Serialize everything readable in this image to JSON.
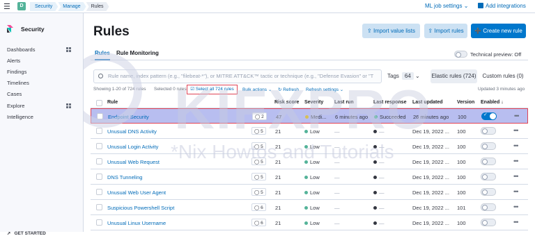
{
  "header": {
    "space_initial": "D",
    "breadcrumbs": [
      "Security",
      "Manage",
      "Rules"
    ],
    "ml_jobs": "ML job settings",
    "add_integrations": "Add integrations"
  },
  "sidebar": {
    "title": "Security",
    "items": [
      {
        "label": "Dashboards",
        "has_grid": true
      },
      {
        "label": "Alerts",
        "has_grid": false
      },
      {
        "label": "Findings",
        "has_grid": false
      },
      {
        "label": "Timelines",
        "has_grid": false
      },
      {
        "label": "Cases",
        "has_grid": false
      },
      {
        "label": "Explore",
        "has_grid": true
      },
      {
        "label": "Intelligence",
        "has_grid": false
      }
    ],
    "get_started": "GET STARTED"
  },
  "page": {
    "title": "Rules",
    "import_value_lists": "Import value lists",
    "import_rules": "Import rules",
    "create_rule": "Create new rule",
    "tabs": [
      "Rules",
      "Rule Monitoring"
    ],
    "technical_preview": "Technical preview: Off"
  },
  "search": {
    "placeholder": "Rule name, index pattern (e.g., \"filebeat-*\"), or MITRE ATT&CK™ tactic or technique (e.g., \"Defense Evasion\" or \"T"
  },
  "filters": {
    "tags_label": "Tags",
    "tags_count": "64",
    "elastic_rules": "Elastic rules (724)",
    "custom_rules": "Custom rules (0)"
  },
  "toolbar": {
    "showing": "Showing 1-20 of 724 rules",
    "selected": "Selected 0 rules",
    "select_all": "Select all 724 rules",
    "bulk_actions": "Bulk actions",
    "refresh": "Refresh",
    "refresh_settings": "Refresh settings",
    "updated": "Updated 3 minutes ago"
  },
  "table": {
    "columns": [
      "Rule",
      "Risk score",
      "Severity",
      "Last run",
      "Last response",
      "Last updated",
      "Version",
      "Enabled"
    ],
    "rows": [
      {
        "name": "Endpoint Security",
        "tags": "2",
        "risk": "47",
        "severity": "Medi...",
        "sev_color": "#d6bf57",
        "last_run": "6 minutes ago",
        "last_response": "Succeeded",
        "resp_color": "#54b399",
        "last_updated": "26 minutes ago",
        "version": "100",
        "enabled": true
      },
      {
        "name": "Unusual DNS Activity",
        "tags": "5",
        "risk": "21",
        "severity": "Low",
        "sev_color": "#54b399",
        "last_run": "—",
        "last_response": "—",
        "resp_color": "#343741",
        "last_updated": "Dec 19, 2022 ...",
        "version": "100",
        "enabled": false
      },
      {
        "name": "Unusual Login Activity",
        "tags": "5",
        "risk": "21",
        "severity": "Low",
        "sev_color": "#54b399",
        "last_run": "—",
        "last_response": "—",
        "resp_color": "#343741",
        "last_updated": "Dec 19, 2022 ...",
        "version": "100",
        "enabled": false
      },
      {
        "name": "Unusual Web Request",
        "tags": "5",
        "risk": "21",
        "severity": "Low",
        "sev_color": "#54b399",
        "last_run": "—",
        "last_response": "—",
        "resp_color": "#343741",
        "last_updated": "Dec 19, 2022 ...",
        "version": "100",
        "enabled": false
      },
      {
        "name": "DNS Tunneling",
        "tags": "5",
        "risk": "21",
        "severity": "Low",
        "sev_color": "#54b399",
        "last_run": "—",
        "last_response": "—",
        "resp_color": "#343741",
        "last_updated": "Dec 19, 2022 ...",
        "version": "100",
        "enabled": false
      },
      {
        "name": "Unusual Web User Agent",
        "tags": "5",
        "risk": "21",
        "severity": "Low",
        "sev_color": "#54b399",
        "last_run": "—",
        "last_response": "—",
        "resp_color": "#343741",
        "last_updated": "Dec 19, 2022 ...",
        "version": "100",
        "enabled": false
      },
      {
        "name": "Suspicious Powershell Script",
        "tags": "6",
        "risk": "21",
        "severity": "Low",
        "sev_color": "#54b399",
        "last_run": "—",
        "last_response": "—",
        "resp_color": "#343741",
        "last_updated": "Dec 19, 2022 ...",
        "version": "101",
        "enabled": false
      },
      {
        "name": "Unusual Linux Username",
        "tags": "6",
        "risk": "21",
        "severity": "Low",
        "sev_color": "#54b399",
        "last_run": "—",
        "last_response": "—",
        "resp_color": "#343741",
        "last_updated": "Dec 19, 2022 ...",
        "version": "100",
        "enabled": false
      }
    ]
  },
  "watermark": {
    "brand": "KIFXPRO",
    "tagline": "*Nix Howtos and Tutorials"
  }
}
